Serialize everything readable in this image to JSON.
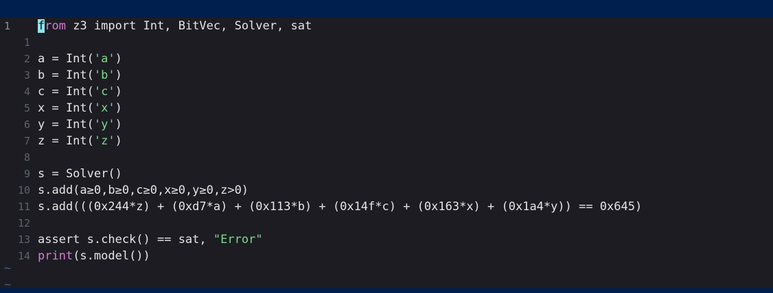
{
  "colors": {
    "title_bar": "#001f4e",
    "editor_background": "#1c1c22",
    "text": "#e6e6e6",
    "line_number": "#5d6470",
    "keyword": "#d77bd3",
    "string": "#7fd98b",
    "cursor": "#8fe3ec"
  },
  "editor": {
    "tilde": "~",
    "lines": [
      {
        "num": "1",
        "code": [
          {
            "t": "from",
            "cls": "cursor-kw"
          },
          {
            "t": " z3 import Int, BitVec, Solver, sat"
          }
        ]
      },
      {
        "num": "1",
        "code": []
      },
      {
        "num": "2",
        "code": [
          {
            "t": "a = Int("
          },
          {
            "t": "'a'",
            "cls": "str"
          },
          {
            "t": ")"
          }
        ]
      },
      {
        "num": "3",
        "code": [
          {
            "t": "b = Int("
          },
          {
            "t": "'b'",
            "cls": "str"
          },
          {
            "t": ")"
          }
        ]
      },
      {
        "num": "4",
        "code": [
          {
            "t": "c = Int("
          },
          {
            "t": "'c'",
            "cls": "str"
          },
          {
            "t": ")"
          }
        ]
      },
      {
        "num": "5",
        "code": [
          {
            "t": "x = Int("
          },
          {
            "t": "'x'",
            "cls": "str"
          },
          {
            "t": ")"
          }
        ]
      },
      {
        "num": "6",
        "code": [
          {
            "t": "y = Int("
          },
          {
            "t": "'y'",
            "cls": "str"
          },
          {
            "t": ")"
          }
        ]
      },
      {
        "num": "7",
        "code": [
          {
            "t": "z = Int("
          },
          {
            "t": "'z'",
            "cls": "str"
          },
          {
            "t": ")"
          }
        ]
      },
      {
        "num": "8",
        "code": []
      },
      {
        "num": "9",
        "code": [
          {
            "t": "s = Solver()"
          }
        ]
      },
      {
        "num": "10",
        "code": [
          {
            "t": "s.add(a≥0,b≥0,c≥0,x≥0,y≥0,z>0)"
          }
        ]
      },
      {
        "num": "11",
        "code": [
          {
            "t": "s.add(((0x244*z) + (0xd7*a) + (0x113*b) + (0x14f*c) + (0x163*x) + (0x1a4*y)) == 0x645)"
          }
        ]
      },
      {
        "num": "12",
        "code": []
      },
      {
        "num": "13",
        "code": [
          {
            "t": "assert s.check() == sat, "
          },
          {
            "t": "\"Error\"",
            "cls": "str"
          }
        ]
      },
      {
        "num": "14",
        "code": [
          {
            "t": "print",
            "cls": "kw"
          },
          {
            "t": "(s.model())"
          }
        ]
      }
    ]
  }
}
